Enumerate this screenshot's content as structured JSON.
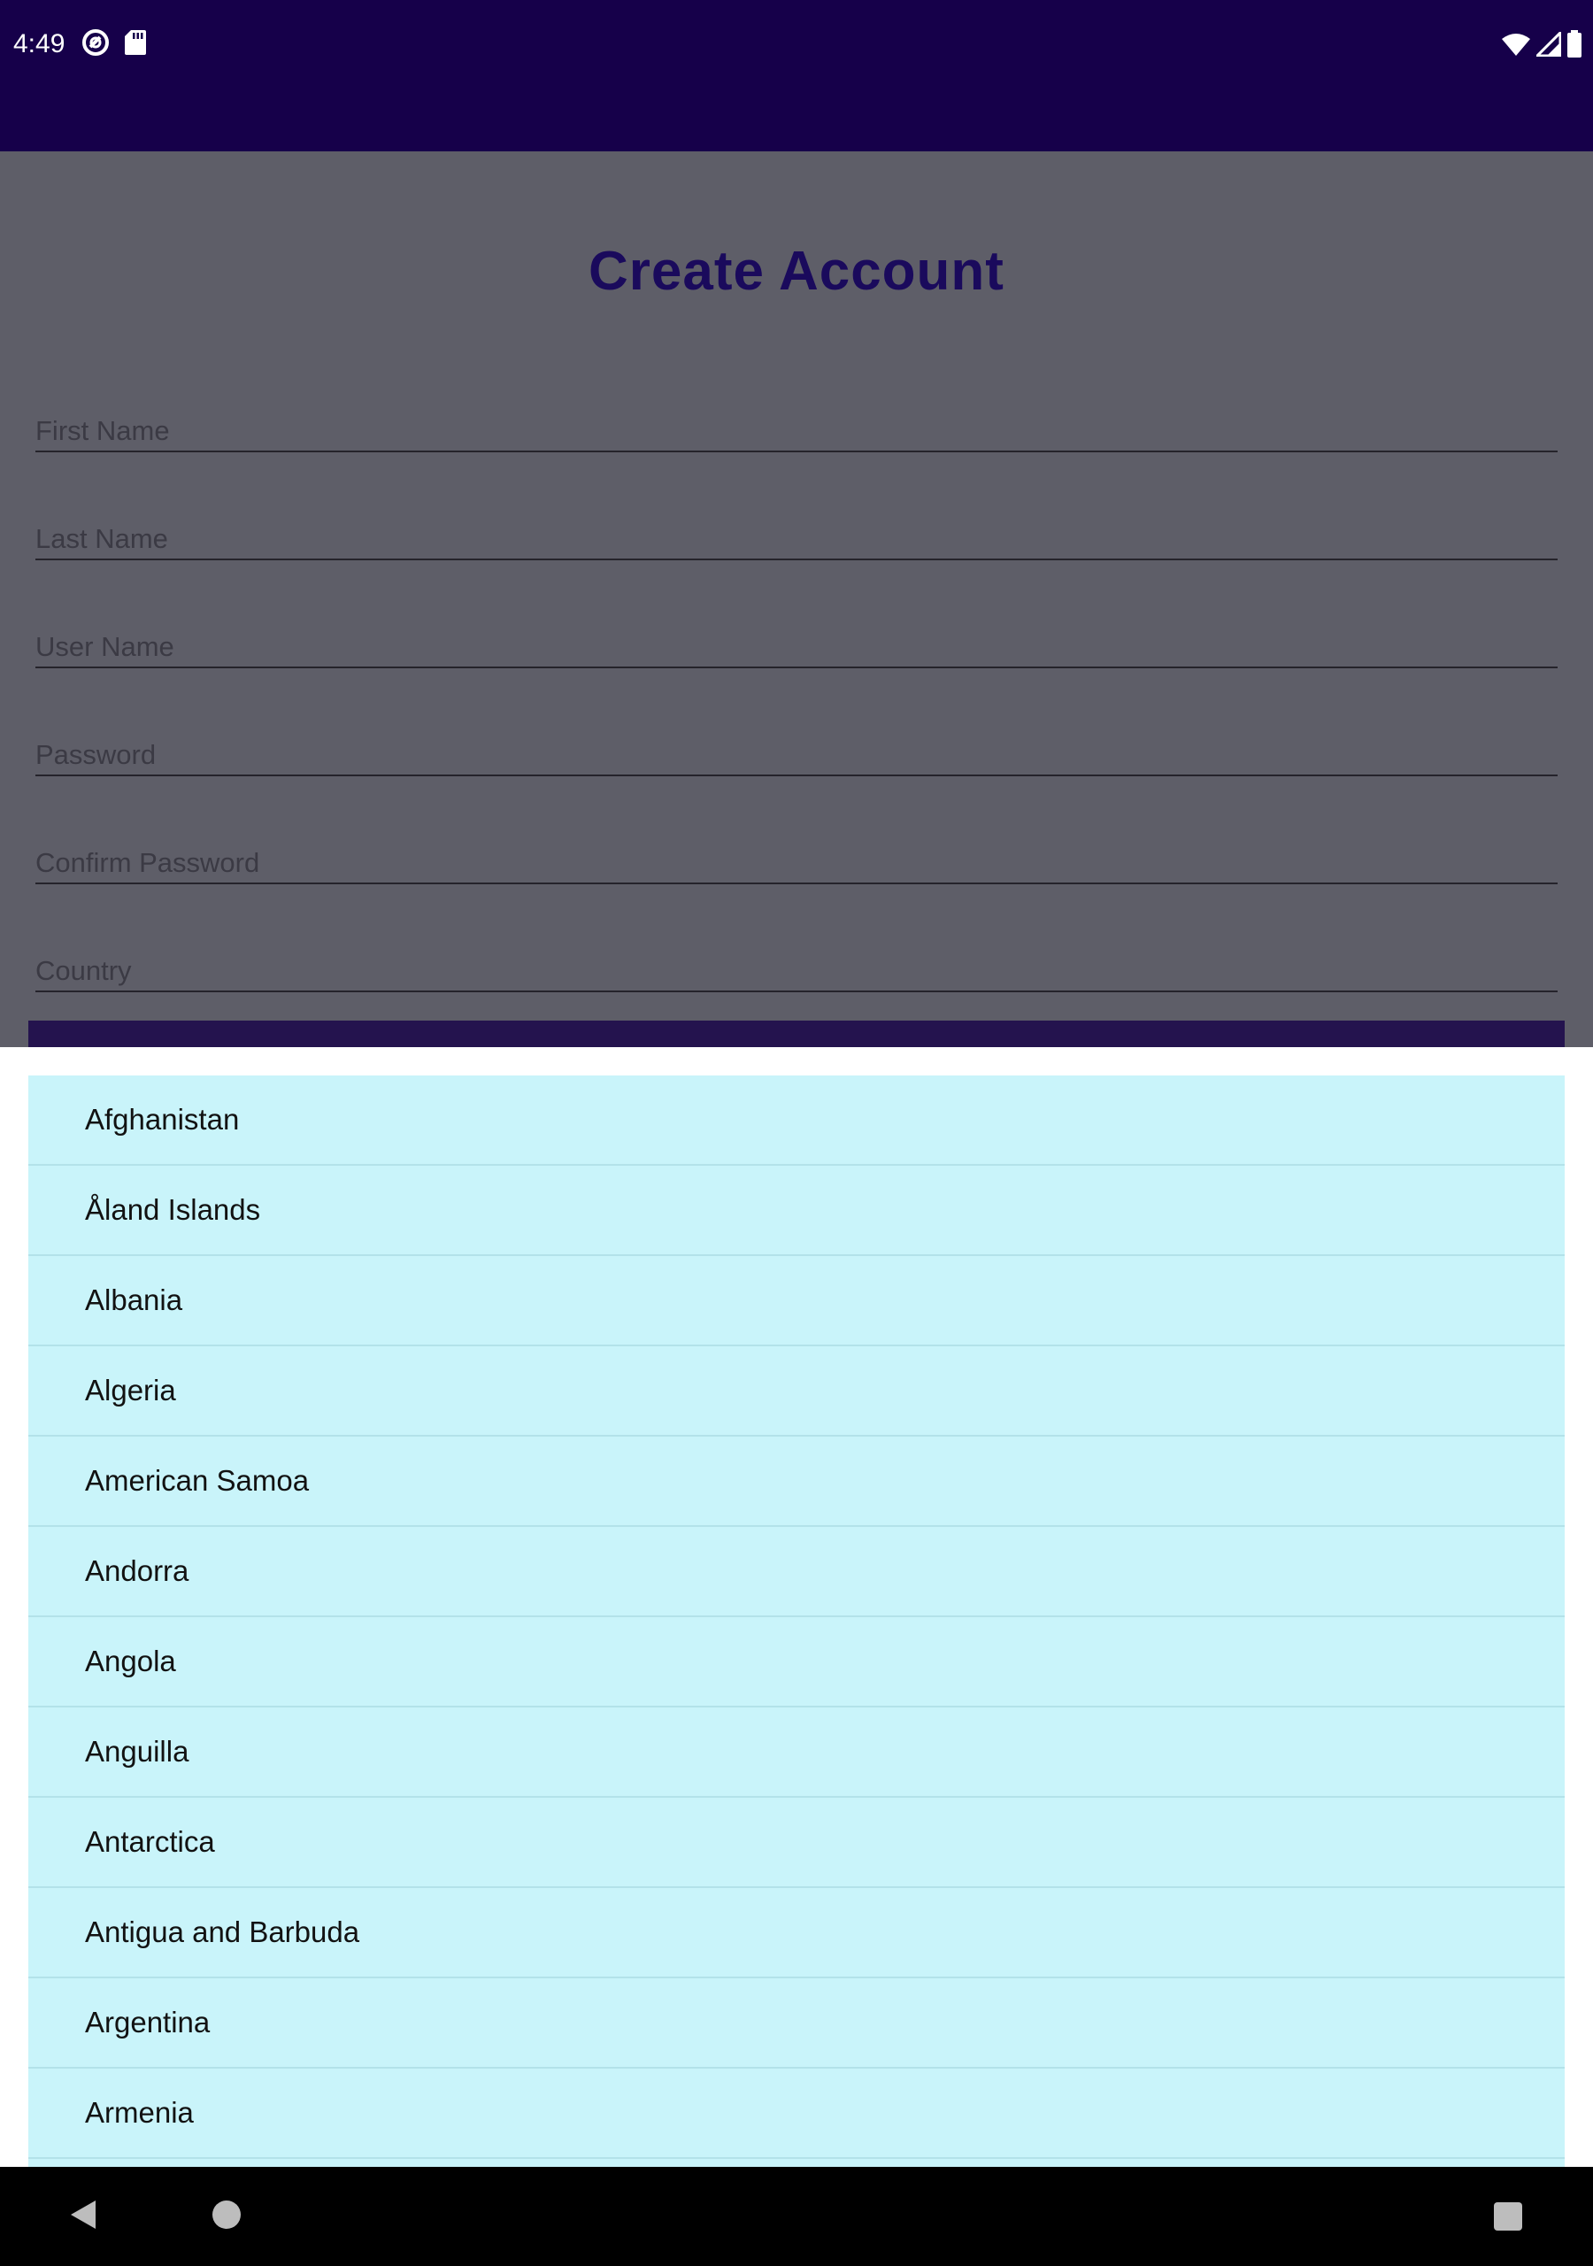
{
  "status_bar": {
    "time": "4:49",
    "left_icons": [
      "sync-icon",
      "sd-card-icon"
    ],
    "right_icons": [
      "wifi-icon",
      "signal-icon",
      "battery-icon"
    ]
  },
  "form": {
    "title": "Create Account",
    "fields": {
      "first_name": {
        "placeholder": "First Name",
        "value": ""
      },
      "last_name": {
        "placeholder": "Last Name",
        "value": ""
      },
      "user_name": {
        "placeholder": "User Name",
        "value": ""
      },
      "password": {
        "placeholder": "Password",
        "value": ""
      },
      "confirm_password": {
        "placeholder": "Confirm Password",
        "value": ""
      },
      "country": {
        "placeholder": "Country",
        "value": ""
      }
    }
  },
  "country_dropdown": {
    "items": [
      "Afghanistan",
      "Åland Islands",
      "Albania",
      "Algeria",
      "American Samoa",
      "Andorra",
      "Angola",
      "Anguilla",
      "Antarctica",
      "Antigua and Barbuda",
      "Argentina",
      "Armenia"
    ]
  },
  "nav_bar": {
    "icons": [
      "back-icon",
      "home-icon",
      "recents-icon"
    ]
  },
  "colors": {
    "status_bar_bg": "#16004a",
    "title": "#1a0a5c",
    "dim_overlay_bg": "#5e5e68",
    "dropdown_item_bg": "#c9f4fa",
    "button_bg": "#24134e"
  }
}
